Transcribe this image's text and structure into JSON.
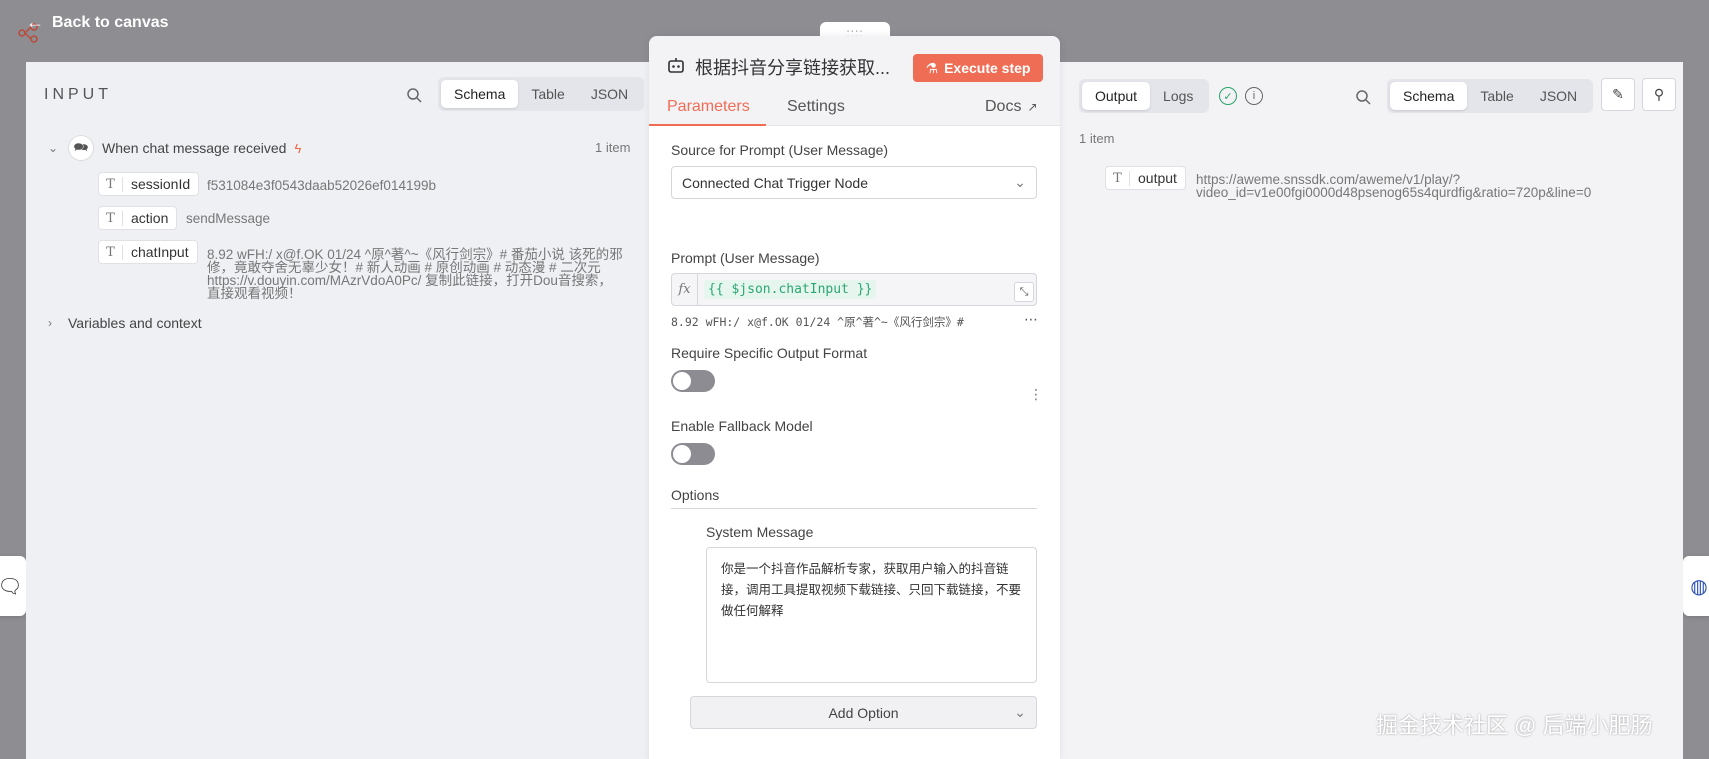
{
  "canvas": {
    "back_label": "Back to canvas"
  },
  "input_panel": {
    "title": "INPUT",
    "view_tabs": [
      "Schema",
      "Table",
      "JSON"
    ],
    "active_tab": "Schema",
    "trigger_node": {
      "label": "When chat message received",
      "item_count": "1 item"
    },
    "fields": [
      {
        "key": "sessionId",
        "value": "f531084e3f0543daab52026ef014199b"
      },
      {
        "key": "action",
        "value": "sendMessage"
      },
      {
        "key": "chatInput",
        "value_lines": [
          "8.92 wFH:/ x@f.OK 01/24 ^原^著^~《风行剑宗》# 番茄小说 该死的邪",
          "修，竟敢夺舍无辜少女！# 新人动画 # 原创动画 # 动态漫 # 二次元",
          "https://v.douyin.com/MAzrVdoA0Pc/ 复制此链接，打开Dou音搜索，",
          "直接观看视频！"
        ]
      }
    ],
    "variables_label": "Variables and context"
  },
  "node_panel": {
    "drag_handle": "::::",
    "title": "根据抖音分享链接获取...",
    "execute_label": "Execute step",
    "tabs": [
      "Parameters",
      "Settings"
    ],
    "active_tab": "Parameters",
    "docs_label": "Docs",
    "source_label": "Source for Prompt (User Message)",
    "source_value": "Connected Chat Trigger Node",
    "prompt_label": "Prompt (User Message)",
    "prompt_expression": "{{ $json.chatInput }}",
    "prompt_preview": "8.92  wFH:/  x@f.OK  01/24  ^原^著^~《风行剑宗》#",
    "require_format_label": "Require Specific Output Format",
    "require_format_on": false,
    "fallback_label": "Enable Fallback Model",
    "fallback_on": false,
    "options_label": "Options",
    "system_message_label": "System Message",
    "system_message_value": "你是一个抖音作品解析专家，获取用户输入的抖音链接，调用工具提取视频下载链接、只回下载链接，不要做任何解释",
    "add_option_label": "Add Option"
  },
  "output_panel": {
    "mode_tabs": [
      "Output",
      "Logs"
    ],
    "active_mode": "Output",
    "view_tabs": [
      "Schema",
      "Table",
      "JSON"
    ],
    "active_tab": "Schema",
    "item_count": "1 item",
    "fields": [
      {
        "key": "output",
        "value_lines": [
          "https://aweme.snssdk.com/aweme/v1/play/?",
          "video_id=v1e00fgi0000d48psenog65s4qurdfig&ratio=720p&line=0"
        ]
      }
    ]
  },
  "watermark": "掘金技术社区 @ 后端小肥肠",
  "colors": {
    "accent": "#ef6d55",
    "success": "#29a36a",
    "expression_green": "#2aa872"
  }
}
